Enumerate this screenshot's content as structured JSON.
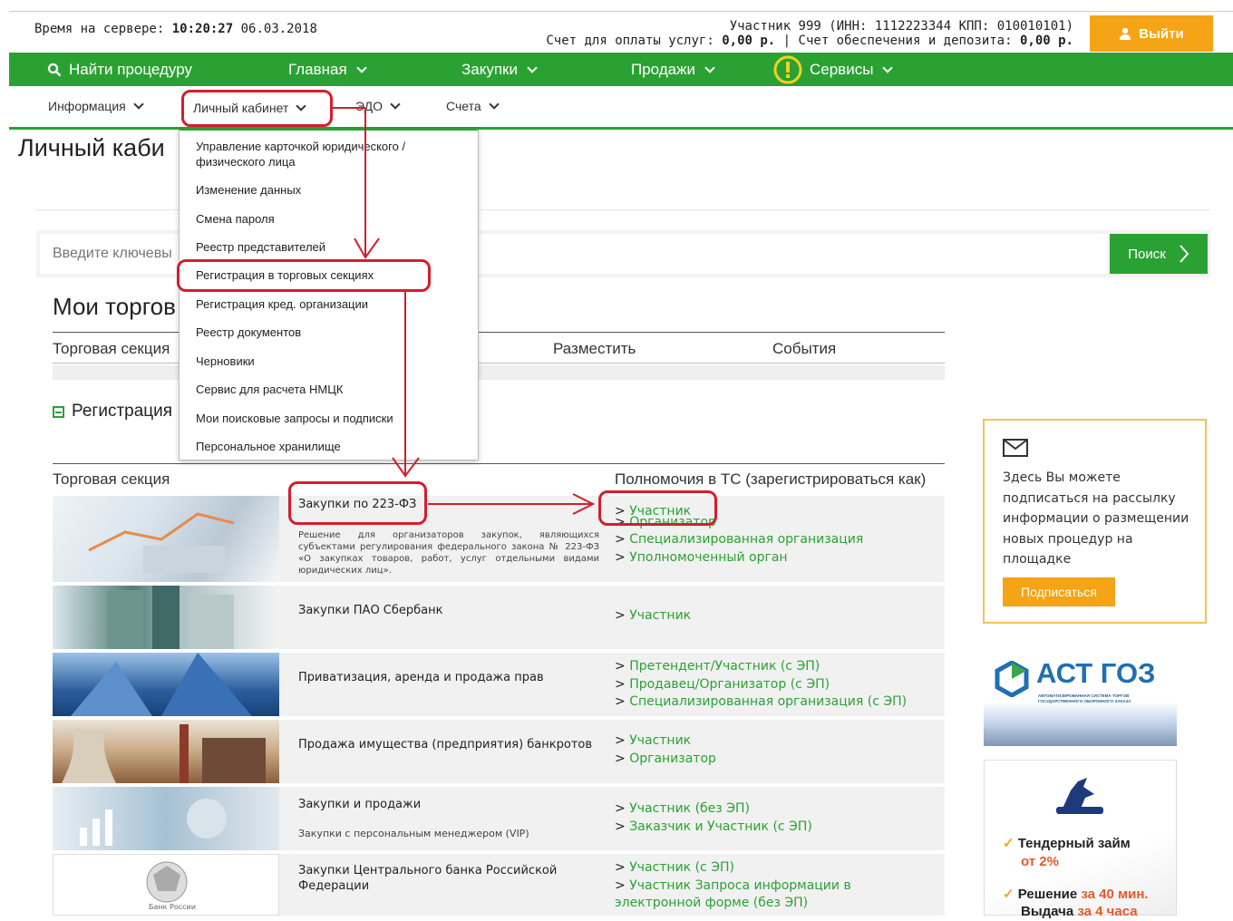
{
  "header": {
    "server_time_label": "Время на сервере:",
    "server_time": "10:20:27",
    "server_date": "06.03.2018",
    "account_line1": "Участник 999 (ИНН: 1112223344 КПП: 010010101)",
    "account_line2_a": "Счет для оплаты услуг:",
    "account_line2_b": "0,00 р.",
    "account_line2_c": "| Счет обеспечения и депозита:",
    "account_line2_d": "0,00 р.",
    "logout_label": "Выйти"
  },
  "main_nav": {
    "find": "Найти процедуру",
    "items": [
      "Главная",
      "Закупки",
      "Продажи",
      "Сервисы"
    ]
  },
  "sub_nav": [
    "Информация",
    "Личный кабинет",
    "ЭДО",
    "Счета"
  ],
  "dropdown": [
    "Управление карточкой юридического / физического лица",
    "Изменение данных",
    "Смена пароля",
    "Реестр представителей",
    "Регистрация в торговых секциях",
    "Регистрация кред. организации",
    "Реестр документов",
    "Черновики",
    "Сервис для расчета НМЦК",
    "Мои поисковые запросы и подписки",
    "Персональное хранилище"
  ],
  "page": {
    "title": "Личный каби",
    "search_placeholder": "Введите ключевы",
    "search_button": "Поиск",
    "my_torg": "Мои торгов",
    "col_section": "Торговая секция",
    "col_place": "Разместить",
    "col_events": "События",
    "reg_toggle": "Регистрация",
    "col_section2": "Торговая секция",
    "col_powers": "Полномочия в ТС (зарегистрироваться как)"
  },
  "sections": [
    {
      "title": "Закупки по 223-ФЗ",
      "desc": "Решение для организаторов закупок, являющихся субъектами регулирования федерального закона № 223-ФЗ «О закупках товаров, работ, услуг отдельными видами юридических лиц».",
      "links": [
        "Участник",
        "Организатор",
        "Специализированная организация",
        "Уполномоченный орган"
      ]
    },
    {
      "title": "Закупки ПАО Сбербанк",
      "desc": "",
      "links": [
        "Участник"
      ]
    },
    {
      "title": "Приватизация, аренда и продажа прав",
      "desc": "",
      "links": [
        "Претендент/Участник (с ЭП)",
        "Продавец/Организатор (с ЭП)",
        "Специализированная организация (с ЭП)"
      ]
    },
    {
      "title": "Продажа имущества (предприятия) банкротов",
      "desc": "",
      "links": [
        "Участник",
        "Организатор"
      ]
    },
    {
      "title": "Закупки и продажи",
      "desc": "Закупки с персональным менеджером (VIP)",
      "links": [
        "Участник (без ЭП)",
        "Заказчик и Участник (с ЭП)"
      ]
    },
    {
      "title": "Закупки Центрального банка Российской Федерации",
      "desc": "",
      "links": [
        "Участник (с ЭП)",
        "Участник Запроса информации в электронной форме (без ЭП)"
      ]
    }
  ],
  "sidebar": {
    "subscribe_text": "Здесь Вы можете подписаться на рассылку информации о размещении новых процедур на площадке",
    "subscribe_button": "Подписаться",
    "ast_logo": "АСТ ГОЗ",
    "ast_sub": "АВТОМАТИЗИРОВАННАЯ СИСТЕМА ТОРГОВ ГОСУДАРСТВЕННОГО ОБОРОННОГО ЗАКАЗА",
    "loan_line1": "Тендерный займ",
    "loan_line2": "от 2%",
    "loan_line3a": "Решение",
    "loan_line3b": "за 40 мин.",
    "loan_line4a": "Выдача",
    "loan_line4b": "за 4 часа",
    "cb_seal": "Банк России"
  },
  "colors": {
    "green": "#2aa233",
    "orange": "#f5a415",
    "red_annotation": "#d21f2b"
  }
}
